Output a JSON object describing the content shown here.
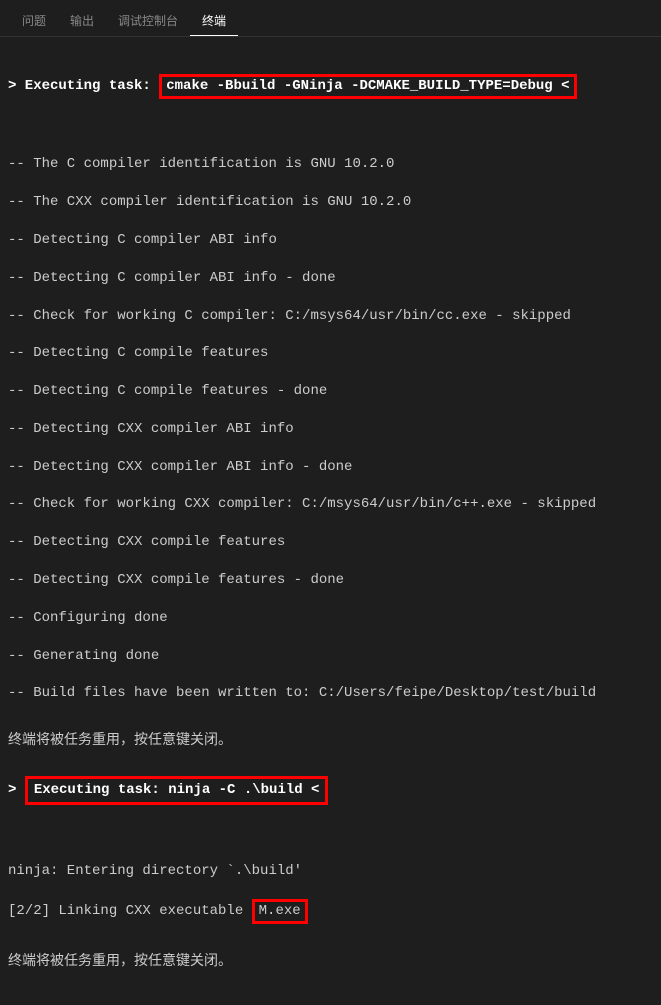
{
  "tabs": {
    "problems": "问题",
    "output": "输出",
    "debug": "调试控制台",
    "terminal": "终端"
  },
  "exec1": {
    "prefix": "> Executing task: ",
    "cmd": "cmake -Bbuild -GNinja -DCMAKE_BUILD_TYPE=Debug <"
  },
  "cmake": {
    "l1": "-- The C compiler identification is GNU 10.2.0",
    "l2": "-- The CXX compiler identification is GNU 10.2.0",
    "l3": "-- Detecting C compiler ABI info",
    "l4": "-- Detecting C compiler ABI info - done",
    "l5": "-- Check for working C compiler: C:/msys64/usr/bin/cc.exe - skipped",
    "l6": "-- Detecting C compile features",
    "l7": "-- Detecting C compile features - done",
    "l8": "-- Detecting CXX compiler ABI info",
    "l9": "-- Detecting CXX compiler ABI info - done",
    "l10": "-- Check for working CXX compiler: C:/msys64/usr/bin/c++.exe - skipped",
    "l11": "-- Detecting CXX compile features",
    "l12": "-- Detecting CXX compile features - done",
    "l13": "-- Configuring done",
    "l14": "-- Generating done",
    "l15": "-- Build files have been written to: C:/Users/feipe/Desktop/test/build"
  },
  "close1": "终端将被任务重用，按任意键关闭。",
  "exec2": {
    "chevron": "> ",
    "full": "Executing task: ninja -C .\\build <"
  },
  "ninja": {
    "l1": "ninja: Entering directory `.\\build'",
    "l2a": "[2/2] Linking CXX executable ",
    "l2b": "M.exe"
  },
  "close2": "终端将被任务重用，按任意键关闭。"
}
